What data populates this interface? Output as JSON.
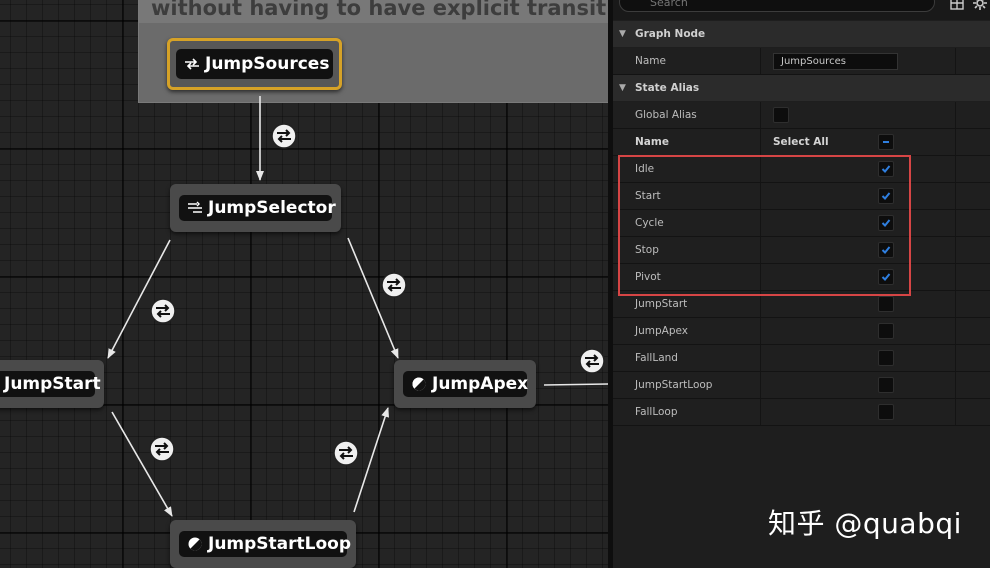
{
  "comment": {
    "text": "without having to have explicit transition li"
  },
  "nodes": [
    {
      "id": "jumpsources",
      "label": "JumpSources",
      "kind": "alias",
      "selected": true
    },
    {
      "id": "jumpselector",
      "label": "JumpSelector",
      "kind": "conduit",
      "selected": false
    },
    {
      "id": "jumpstart",
      "label": "JumpStart",
      "kind": "state",
      "selected": false
    },
    {
      "id": "jumpapex",
      "label": "JumpApex",
      "kind": "state",
      "selected": false
    },
    {
      "id": "jumpstartloop",
      "label": "JumpStartLoop",
      "kind": "state",
      "selected": false
    }
  ],
  "details": {
    "search_placeholder": "Search",
    "categories": {
      "graph_node": "Graph Node",
      "state_alias": "State Alias"
    },
    "name_label": "Name",
    "name_value": "JumpSources",
    "global_alias_label": "Global Alias",
    "global_alias_checked": false,
    "list_header": {
      "name": "Name",
      "select_all": "Select All"
    },
    "states": [
      {
        "name": "Idle",
        "checked": true
      },
      {
        "name": "Start",
        "checked": true
      },
      {
        "name": "Cycle",
        "checked": true
      },
      {
        "name": "Stop",
        "checked": true
      },
      {
        "name": "Pivot",
        "checked": true
      },
      {
        "name": "JumpStart",
        "checked": false
      },
      {
        "name": "JumpApex",
        "checked": false
      },
      {
        "name": "FallLand",
        "checked": false
      },
      {
        "name": "JumpStartLoop",
        "checked": false
      },
      {
        "name": "FallLoop",
        "checked": false
      }
    ]
  },
  "colors": {
    "selection": "#d6a227",
    "highlight_box": "#d64545",
    "checkbox_accent": "#2f7fe0"
  },
  "icons": {
    "search": "search-icon",
    "grid_view": "grid-view-icon",
    "settings": "gear-icon",
    "transition": "transition-icon"
  },
  "watermark": "知乎 @quabqi"
}
